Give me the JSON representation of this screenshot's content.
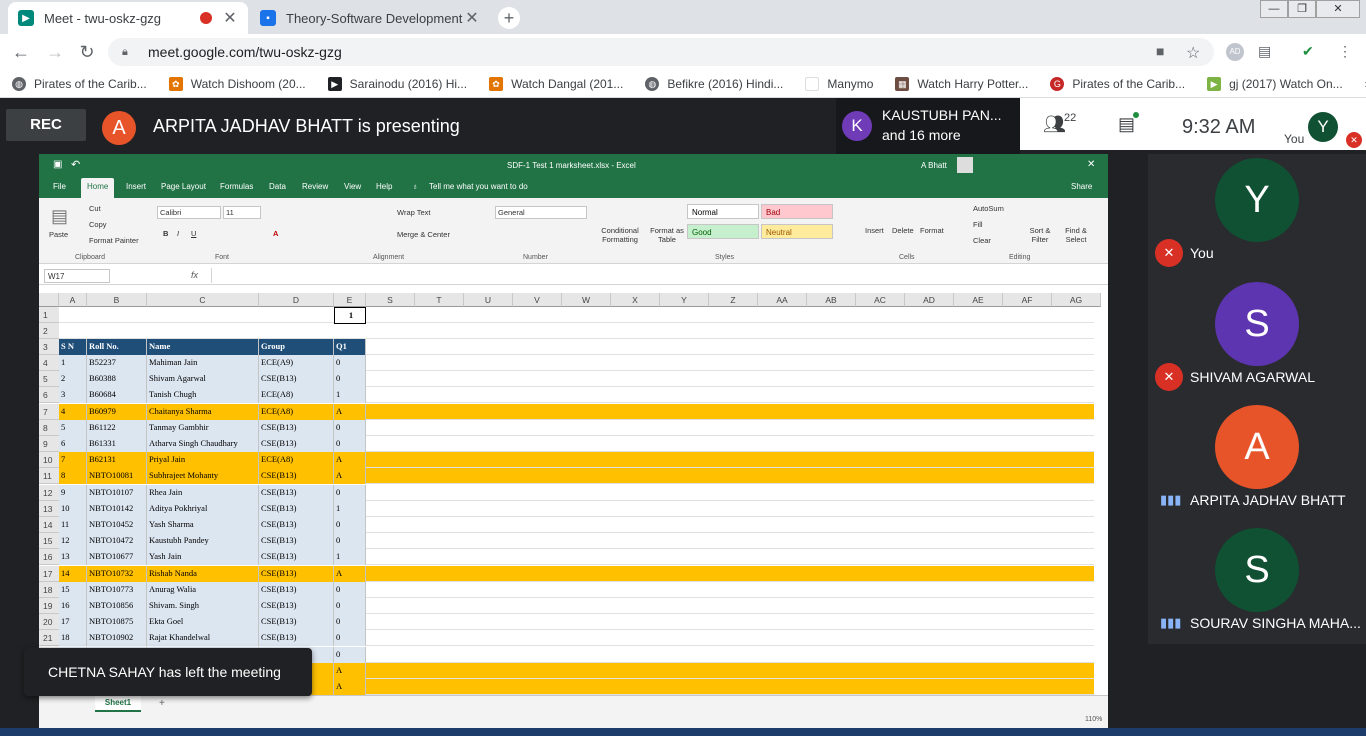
{
  "browser": {
    "tabs": [
      {
        "title": "Meet - twu-oskz-gzg",
        "icon": "meet-icon",
        "recording": true
      },
      {
        "title": "Theory-Software Development F...",
        "icon": "classroom-icon"
      }
    ],
    "new_tab": "+",
    "url": "meet.google.com/twu-oskz-gzg",
    "profile": "AD",
    "bookmarks": [
      {
        "label": "Pirates of the Carib...",
        "icon": "globe-icon"
      },
      {
        "label": "Watch Dishoom (20...",
        "icon": "popcorn-icon"
      },
      {
        "label": "Sarainodu (2016) Hi...",
        "icon": "play-icon"
      },
      {
        "label": "Watch Dangal (201...",
        "icon": "popcorn-icon"
      },
      {
        "label": "Befikre (2016) Hindi...",
        "icon": "globe-icon"
      },
      {
        "label": "Manymo",
        "icon": "page-icon"
      },
      {
        "label": "Watch Harry Potter...",
        "icon": "film-icon"
      },
      {
        "label": "Pirates of the Carib...",
        "icon": "geo-icon"
      },
      {
        "label": "gj (2017) Watch On...",
        "icon": "green-play-icon"
      }
    ],
    "more_bookmarks": "»"
  },
  "meet": {
    "rec_label": "REC",
    "presenter_initial": "A",
    "presenter_text": "ARPITA JADHAV BHATT is presenting",
    "pinned": {
      "initial": "K",
      "name": "KAUSTUBH PAN...",
      "more": "and 16 more"
    },
    "participant_count": "22",
    "time": "9:32  AM",
    "self_label": "You",
    "self_initial": "Y",
    "participants": [
      {
        "initial": "Y",
        "name": "You",
        "color": "#0f5132",
        "muted": true
      },
      {
        "initial": "S",
        "name": "SHIVAM AGARWAL",
        "color": "#5e35b1",
        "muted": true
      },
      {
        "initial": "A",
        "name": "ARPITA JADHAV BHATT",
        "color": "#e8542a",
        "muted": false
      },
      {
        "initial": "S",
        "name": "SOURAV SINGHA MAHA...",
        "color": "#0f5132",
        "muted": false
      }
    ],
    "toast": "CHETNA SAHAY has left the meeting"
  },
  "excel": {
    "title": "SDF-1 Test 1 marksheet.xlsx  -  Excel",
    "user": "A Bhatt",
    "tabs": [
      "File",
      "Home",
      "Insert",
      "Page Layout",
      "Formulas",
      "Data",
      "Review",
      "View",
      "Help"
    ],
    "tell_me": "Tell me what you want to do",
    "share": "Share",
    "ribbon": {
      "cut": "Cut",
      "copy": "Copy",
      "paste": "Paste",
      "format_painter": "Format Painter",
      "font_name": "Calibri",
      "font_size": "11",
      "wrap_text": "Wrap Text",
      "merge_center": "Merge & Center",
      "number_format": "General",
      "conditional": "Conditional Formatting",
      "format_as": "Format as Table",
      "styles": {
        "normal": "Normal",
        "bad": "Bad",
        "good": "Good",
        "neutral": "Neutral"
      },
      "insert": "Insert",
      "delete": "Delete",
      "format": "Format",
      "autosum": "AutoSum",
      "fill": "Fill",
      "clear": "Clear",
      "sort_filter": "Sort & Filter",
      "find_select": "Find & Select",
      "groups": [
        "Clipboard",
        "Font",
        "Alignment",
        "Number",
        "Styles",
        "Cells",
        "Editing"
      ]
    },
    "name_box": "W17",
    "fx": "fx",
    "columns": [
      "A",
      "B",
      "C",
      "D",
      "E",
      "S",
      "T",
      "U",
      "V",
      "W",
      "X",
      "Y",
      "Z",
      "AA",
      "AB",
      "AC",
      "AD",
      "AE",
      "AF",
      "AG"
    ],
    "e1_value": "1",
    "table_headers": [
      "S N",
      "Roll No.",
      "Name",
      "Group",
      "Q1"
    ],
    "rows": [
      {
        "n": "4",
        "sn": "1",
        "roll": "B52237",
        "name": "Mahiman Jain",
        "group": "ECE(A9)",
        "q1": "0",
        "hl": false
      },
      {
        "n": "5",
        "sn": "2",
        "roll": "B60388",
        "name": "Shivam Agarwal",
        "group": "CSE(B13)",
        "q1": "0",
        "hl": false
      },
      {
        "n": "6",
        "sn": "3",
        "roll": "B60684",
        "name": "Tanish Chugh",
        "group": "ECE(A8)",
        "q1": "1",
        "hl": false
      },
      {
        "n": "7",
        "sn": "4",
        "roll": "B60979",
        "name": "Chaitanya Sharma",
        "group": "ECE(A8)",
        "q1": "A",
        "hl": true
      },
      {
        "n": "8",
        "sn": "5",
        "roll": "B61122",
        "name": "Tanmay Gambhir",
        "group": "CSE(B13)",
        "q1": "0",
        "hl": false
      },
      {
        "n": "9",
        "sn": "6",
        "roll": "B61331",
        "name": "Atharva Singh Chaudhary",
        "group": "CSE(B13)",
        "q1": "0",
        "hl": false
      },
      {
        "n": "10",
        "sn": "7",
        "roll": "B62131",
        "name": "Priyal Jain",
        "group": "ECE(A8)",
        "q1": "A",
        "hl": true
      },
      {
        "n": "11",
        "sn": "8",
        "roll": "NBTO10081",
        "name": "Subhrajeet Mohanty",
        "group": "CSE(B13)",
        "q1": "A",
        "hl": true
      },
      {
        "n": "12",
        "sn": "9",
        "roll": "NBTO10107",
        "name": "Rhea Jain",
        "group": "CSE(B13)",
        "q1": "0",
        "hl": false
      },
      {
        "n": "13",
        "sn": "10",
        "roll": "NBTO10142",
        "name": "Aditya Pokhriyal",
        "group": "CSE(B13)",
        "q1": "1",
        "hl": false
      },
      {
        "n": "14",
        "sn": "11",
        "roll": "NBTO10452",
        "name": "Yash Sharma",
        "group": "CSE(B13)",
        "q1": "0",
        "hl": false
      },
      {
        "n": "15",
        "sn": "12",
        "roll": "NBTO10472",
        "name": "Kaustubh Pandey",
        "group": "CSE(B13)",
        "q1": "0",
        "hl": false
      },
      {
        "n": "16",
        "sn": "13",
        "roll": "NBTO10677",
        "name": "Yash Jain",
        "group": "CSE(B13)",
        "q1": "1",
        "hl": false
      },
      {
        "n": "17",
        "sn": "14",
        "roll": "NBTO10732",
        "name": "Rishab Nanda",
        "group": "CSE(B13)",
        "q1": "A",
        "hl": true
      },
      {
        "n": "18",
        "sn": "15",
        "roll": "NBTO10773",
        "name": "Anurag Walia",
        "group": "CSE(B13)",
        "q1": "0",
        "hl": false
      },
      {
        "n": "19",
        "sn": "16",
        "roll": "NBTO10856",
        "name": "Shivam. Singh",
        "group": "CSE(B13)",
        "q1": "0",
        "hl": false
      },
      {
        "n": "20",
        "sn": "17",
        "roll": "NBTO10875",
        "name": "Ekta Goel",
        "group": "CSE(B13)",
        "q1": "0",
        "hl": false
      },
      {
        "n": "21",
        "sn": "18",
        "roll": "NBTO10902",
        "name": "Rajat Khandelwal",
        "group": "CSE(B13)",
        "q1": "0",
        "hl": false
      },
      {
        "n": "",
        "sn": "",
        "roll": "",
        "name": "",
        "group": "",
        "q1": "0",
        "hl": false
      },
      {
        "n": "",
        "sn": "",
        "roll": "",
        "name": "",
        "group": "",
        "q1": "A",
        "hl": true
      },
      {
        "n": "",
        "sn": "",
        "roll": "",
        "name": "",
        "group": "",
        "q1": "A",
        "hl": true
      }
    ],
    "sheet_tab": "Sheet1",
    "add_sheet": "+",
    "zoom": "110%"
  }
}
